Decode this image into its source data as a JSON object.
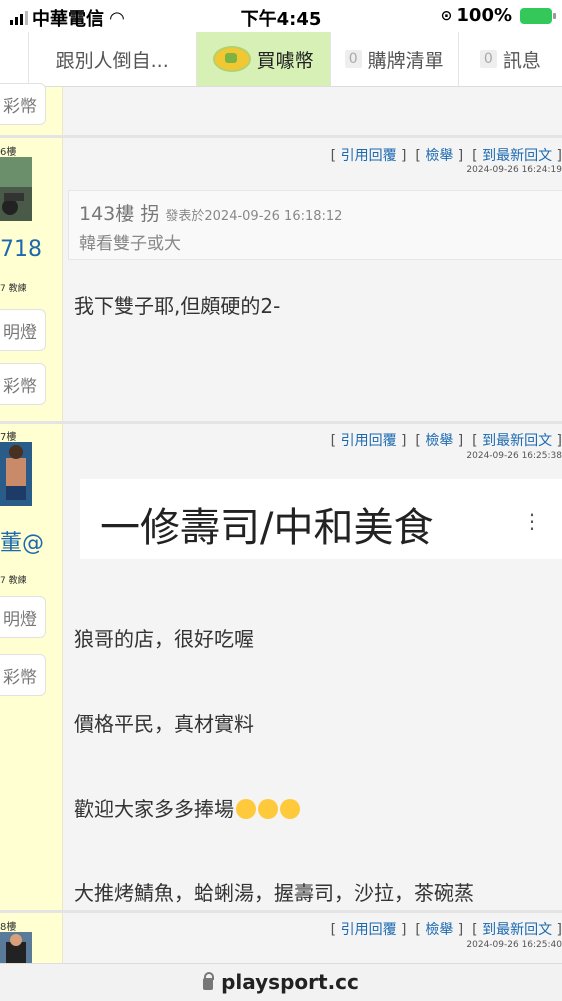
{
  "status_bar": {
    "carrier": "中華電信",
    "time": "下午4:45",
    "battery": "100%"
  },
  "tabs": [
    {
      "label": "跟別人倒自..."
    },
    {
      "label": "買噱幣"
    },
    {
      "count": "0",
      "label": "購牌清單"
    },
    {
      "count": "0",
      "label": "訊息"
    }
  ],
  "sidebar_top": {
    "btn_coin": "彩幣"
  },
  "posts": [
    {
      "floor_side": "6樓",
      "user_name": "718",
      "rank": "7 教練",
      "btn_light": "明燈",
      "btn_coin": "彩幣",
      "links": {
        "quote": "引用回覆",
        "report": "檢舉",
        "latest": "到最新回文"
      },
      "time": "2024-09-26 16:24:19",
      "quote": {
        "floor": "143樓",
        "user": "拐",
        "posted": "發表於2024-09-26 16:18:12",
        "body": "韓看雙子或大"
      },
      "text": "我下雙子耶,但頗硬的2-"
    },
    {
      "floor_side": "7樓",
      "user_name": "董@",
      "rank": "7 教練",
      "btn_light": "明燈",
      "btn_coin": "彩幣",
      "links": {
        "quote": "引用回覆",
        "report": "檢舉",
        "latest": "到最新回文"
      },
      "time": "2024-09-26 16:25:38",
      "embed_title": "一修壽司/中和美食",
      "lines": [
        "狼哥的店，很好吃喔",
        "價格平民，真材實料",
        "歡迎大家多多捧場",
        "大推烤鯖魚，蛤蜊湯，握壽司，沙拉，茶碗蒸"
      ]
    },
    {
      "floor_side": "8樓",
      "links": {
        "quote": "引用回覆",
        "report": "檢舉",
        "latest": "到最新回文"
      },
      "time": "2024-09-26 16:25:40"
    }
  ],
  "address_bar": {
    "url": "playsport.cc"
  }
}
